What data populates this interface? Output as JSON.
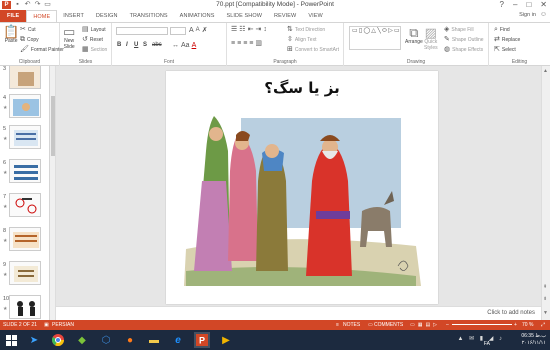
{
  "window": {
    "title": "70.ppt [Compatibility Mode] - PowerPoint",
    "controls": {
      "help": "?",
      "minimize": "–",
      "restore": "□",
      "close": "✕"
    }
  },
  "tabs": [
    "FILE",
    "HOME",
    "INSERT",
    "DESIGN",
    "TRANSITIONS",
    "ANIMATIONS",
    "SLIDE SHOW",
    "REVIEW",
    "VIEW"
  ],
  "active_tab": "HOME",
  "account": {
    "sign_in": "Sign in"
  },
  "ribbon": {
    "clipboard": {
      "paste": "Paste",
      "cut": "Cut",
      "copy": "Copy",
      "format_painter": "Format Painter",
      "label": "Clipboard"
    },
    "slides": {
      "new_slide": "New",
      "new_slide_2": "Slide",
      "layout": "Layout",
      "reset": "Reset",
      "section": "Section",
      "label": "Slides"
    },
    "font": {
      "bold": "B",
      "italic": "I",
      "underline": "U",
      "strike": "S",
      "shadow": "abc",
      "label": "Font"
    },
    "paragraph": {
      "text_direction": "Text Direction",
      "align_text": "Align Text",
      "smartart": "Convert to SmartArt",
      "label": "Paragraph"
    },
    "drawing": {
      "arrange": "Arrange",
      "quick_styles": "Quick",
      "quick_styles_2": "Styles",
      "shape_fill": "Shape Fill",
      "shape_outline": "Shape Outline",
      "shape_effects": "Shape Effects",
      "label": "Drawing"
    },
    "editing": {
      "find": "Find",
      "replace": "Replace",
      "select": "Select",
      "label": "Editing"
    }
  },
  "thumbnails": [
    {
      "num": "3"
    },
    {
      "num": "4"
    },
    {
      "num": "5"
    },
    {
      "num": "6"
    },
    {
      "num": "7"
    },
    {
      "num": "8"
    },
    {
      "num": "9"
    },
    {
      "num": "10"
    }
  ],
  "slide": {
    "title": "بز یا سگ؟"
  },
  "notes": {
    "placeholder": "Click to add notes"
  },
  "status": {
    "slide_info": "SLIDE 2 OF 21",
    "language": "PERSIAN",
    "notes": "NOTES",
    "comments": "COMMENTS",
    "zoom": "70 %"
  },
  "taskbar": {
    "lang": "FA",
    "time": "06:35 ب.ظ",
    "date": "۲۰۱۶/۱۱/۱۱"
  },
  "colors": {
    "accent": "#d24726",
    "taskbar": "#1c2a3f"
  }
}
